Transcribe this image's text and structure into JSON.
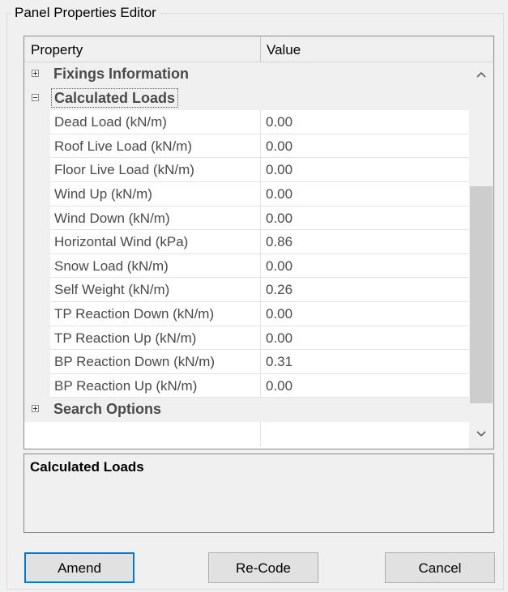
{
  "group_title": "Panel Properties Editor",
  "grid": {
    "columns": {
      "property": "Property",
      "value": "Value"
    },
    "categories": [
      {
        "label": "Fixings Information",
        "expanded": false,
        "selected": false
      },
      {
        "label": "Calculated Loads",
        "expanded": true,
        "selected": true,
        "items": [
          {
            "label": "Dead Load (kN/m)",
            "value": "0.00"
          },
          {
            "label": "Roof Live Load (kN/m)",
            "value": "0.00"
          },
          {
            "label": "Floor Live Load (kN/m)",
            "value": "0.00"
          },
          {
            "label": "Wind Up (kN/m)",
            "value": "0.00"
          },
          {
            "label": "Wind Down (kN/m)",
            "value": "0.00"
          },
          {
            "label": "Horizontal Wind (kPa)",
            "value": "0.86"
          },
          {
            "label": "Snow Load (kN/m)",
            "value": "0.00"
          },
          {
            "label": "Self Weight (kN/m)",
            "value": "0.26"
          },
          {
            "label": "TP Reaction Down (kN/m)",
            "value": "0.00"
          },
          {
            "label": "TP Reaction Up (kN/m)",
            "value": "0.00"
          },
          {
            "label": "BP Reaction Down (kN/m)",
            "value": "0.31"
          },
          {
            "label": "BP Reaction Up (kN/m)",
            "value": "0.00"
          }
        ]
      },
      {
        "label": "Search Options",
        "expanded": false,
        "selected": false
      }
    ],
    "icons": {
      "expand": "plus-box-icon",
      "collapse": "minus-box-icon",
      "scroll_up": "chevron-up-icon",
      "scroll_down": "chevron-down-icon"
    }
  },
  "description": {
    "title": "Calculated Loads"
  },
  "buttons": {
    "amend": "Amend",
    "recode": "Re-Code",
    "cancel": "Cancel"
  },
  "colors": {
    "default_button_border": "#0078d7",
    "muted_text": "#4a4a4a"
  }
}
